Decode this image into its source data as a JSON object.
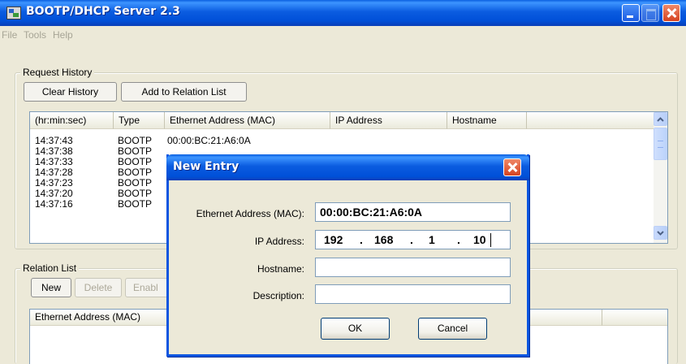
{
  "window": {
    "title": "BOOTP/DHCP Server 2.3"
  },
  "menu": [
    "File",
    "Tools",
    "Help"
  ],
  "request_history": {
    "legend": "Request History",
    "clear_button": "Clear History",
    "add_button": "Add to Relation List",
    "columns": [
      "(hr:min:sec)",
      "Type",
      "Ethernet Address (MAC)",
      "IP Address",
      "Hostname"
    ],
    "rows": [
      {
        "time": "14:37:43",
        "type": "BOOTP",
        "mac": "00:00:BC:21:A6:0A"
      },
      {
        "time": "14:37:38",
        "type": "BOOTP",
        "mac": ""
      },
      {
        "time": "14:37:33",
        "type": "BOOTP",
        "mac": ""
      },
      {
        "time": "14:37:28",
        "type": "BOOTP",
        "mac": ""
      },
      {
        "time": "14:37:23",
        "type": "BOOTP",
        "mac": ""
      },
      {
        "time": "14:37:20",
        "type": "BOOTP",
        "mac": ""
      },
      {
        "time": "14:37:16",
        "type": "BOOTP",
        "mac": ""
      }
    ]
  },
  "relation_list": {
    "legend": "Relation List",
    "new_button": "New",
    "delete_button": "Delete",
    "enable_button": "Enabl",
    "columns": [
      "Ethernet Address (MAC)"
    ]
  },
  "dialog": {
    "title": "New Entry",
    "mac_label": "Ethernet Address (MAC):",
    "mac_value": "00:00:BC:21:A6:0A",
    "ip_label": "IP Address:",
    "ip_octets": [
      "192",
      "168",
      "1",
      "10"
    ],
    "ip_dots": [
      ".",
      ".",
      "."
    ],
    "hostname_label": "Hostname:",
    "hostname_value": "",
    "description_label": "Description:",
    "description_value": "",
    "ok_button": "OK",
    "cancel_button": "Cancel"
  }
}
